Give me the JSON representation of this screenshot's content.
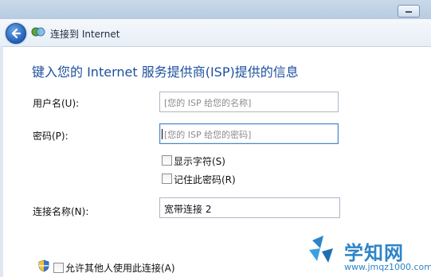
{
  "window": {
    "title": "连接到 Internet"
  },
  "page": {
    "heading": "键入您的 Internet 服务提供商(ISP)提供的信息"
  },
  "form": {
    "username_label": "用户名(U):",
    "username_placeholder": "[您的 ISP 给您的名称]",
    "password_label": "密码(P):",
    "password_placeholder": "[您的 ISP 给您的密码]",
    "show_chars_label": "显示字符(S)",
    "remember_password_label": "记住此密码(R)",
    "connection_name_label": "连接名称(N):",
    "connection_name_value": "宽带连接 2",
    "allow_others_label": "允许其他人使用此连接(A)"
  },
  "watermark": {
    "title": "学知网",
    "url": "www.jmqz1000.com"
  },
  "colors": {
    "heading": "#1c4f9c",
    "back_button": "#1f5fb8",
    "watermark": "#2e84c6"
  },
  "icons": [
    "back-arrow-icon",
    "network-icon",
    "shield-icon",
    "watermark-logo-icon"
  ]
}
